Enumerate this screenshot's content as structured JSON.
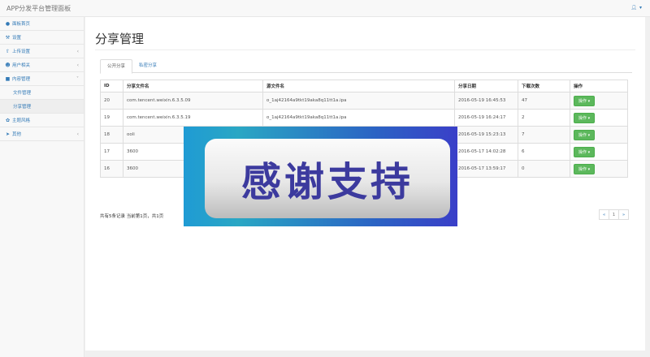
{
  "app": {
    "title": "APP分发平台管理面板"
  },
  "topbar": {
    "user_icon": "user-icon"
  },
  "sidebar": {
    "items": [
      {
        "label": "面板首页",
        "icon": "dashboard-icon",
        "has_arrow": false
      },
      {
        "label": "设置",
        "icon": "wrench-icon",
        "has_arrow": false
      },
      {
        "label": "上传设置",
        "icon": "upload-icon",
        "has_arrow": true
      },
      {
        "label": "用户相关",
        "icon": "users-icon",
        "has_arrow": true
      },
      {
        "label": "内容管理",
        "icon": "folder-icon",
        "has_arrow": true
      },
      {
        "label": "文件管理",
        "icon": "",
        "has_arrow": false,
        "sub": true
      },
      {
        "label": "分享管理",
        "icon": "",
        "has_arrow": false,
        "sub": true,
        "active": true
      },
      {
        "label": "主题风格",
        "icon": "palette-icon",
        "has_arrow": false
      },
      {
        "label": "其他",
        "icon": "paper-plane-icon",
        "has_arrow": true
      }
    ]
  },
  "main": {
    "title": "分享管理",
    "tabs": [
      {
        "label": "公开分享",
        "active": true
      },
      {
        "label": "私密分享",
        "active": false
      }
    ],
    "table": {
      "headers": [
        "ID",
        "分享文件名",
        "源文件名",
        "分享日期",
        "下载次数",
        "操作"
      ],
      "rows": [
        {
          "id": "20",
          "share_name": "com.tencent.weixin.6.3.5.09",
          "source": "o_1aj42164a9tkt19aka8q11tt1a.ipa",
          "date": "2016-05-19 16:45:53",
          "downloads": "47",
          "action": "操作"
        },
        {
          "id": "19",
          "share_name": "com.tencent.weixin.6.3.5.19",
          "source": "o_1aj42164a9tkt19aka8q11tt1a.ipa",
          "date": "2016-05-19 16:24:17",
          "downloads": "2",
          "action": "操作"
        },
        {
          "id": "18",
          "share_name": "ooli",
          "source": "",
          "date": "2016-05-19 15:23:13",
          "downloads": "7",
          "action": "操作"
        },
        {
          "id": "17",
          "share_name": "3600",
          "source": "",
          "date": "2016-05-17 14:02:28",
          "downloads": "6",
          "action": "操作"
        },
        {
          "id": "16",
          "share_name": "3600",
          "source": "",
          "date": "2016-05-17 13:59:17",
          "downloads": "0",
          "action": "操作"
        }
      ]
    },
    "footer_info": "共有5条记录  当前第1页，共1页",
    "pager": {
      "prev": "«",
      "current": "1",
      "next": "»"
    }
  },
  "overlay": {
    "text": "感谢支持"
  }
}
